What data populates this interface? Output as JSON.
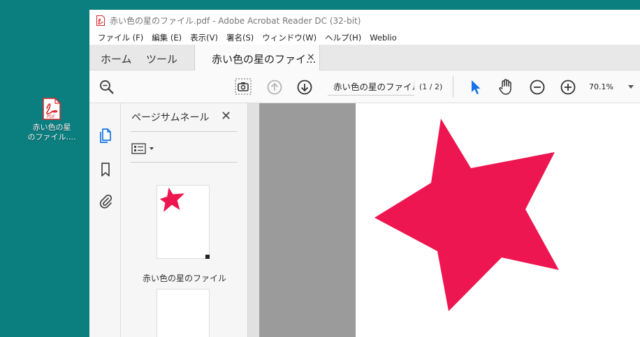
{
  "desktop": {
    "icon": "pdf-file-icon",
    "label_line1": "赤い色の星",
    "label_line2": "のファイル....",
    "icon_badge": "PDF"
  },
  "window": {
    "title": "赤い色の星のファイル.pdf - Adobe Acrobat Reader DC (32-bit)",
    "menu": [
      "ファイル (F)",
      "編集 (E)",
      "表示(V)",
      "署名(S)",
      "ウィンドウ(W)",
      "ヘルプ(H)",
      "Weblio"
    ],
    "tabs": {
      "home": "ホーム",
      "tools": "ツール",
      "document": "赤い色の星のファイ...",
      "close_icon": "×"
    },
    "toolbar": {
      "page_title": "赤い色の星のファイル",
      "page_count": "(1 / 2)",
      "zoom": "70.1%"
    },
    "thumbnails": {
      "title": "ページサムネール",
      "close": "✕",
      "caption": "赤い色の星のファイル"
    }
  },
  "colors": {
    "desktop": "#0b7f80",
    "star": "#ee1650",
    "acrobat_red": "#d7262c",
    "select_blue": "#1473e6"
  }
}
